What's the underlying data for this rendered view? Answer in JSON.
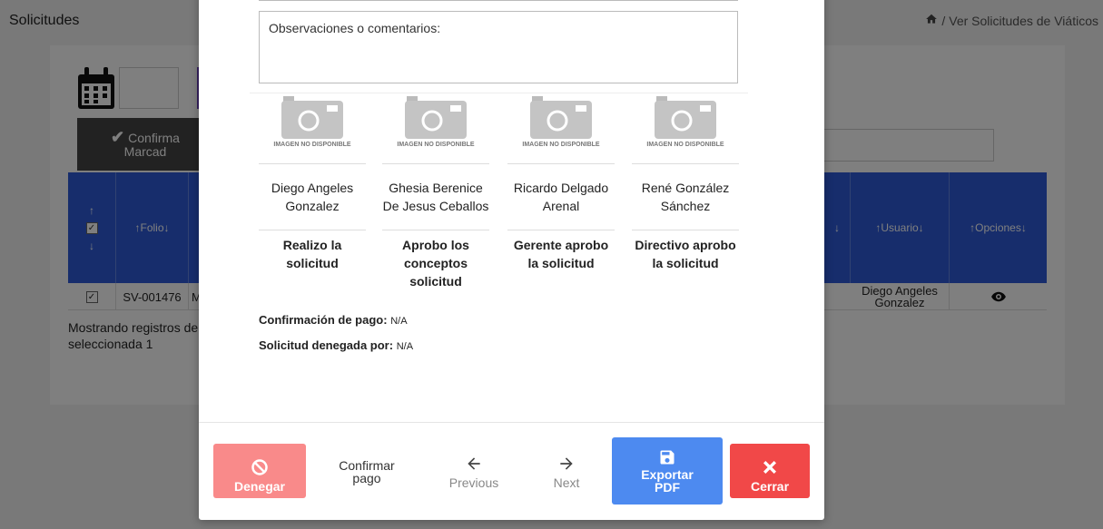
{
  "background": {
    "page_title": "Solicitudes",
    "breadcrumb": "Ver Solicitudes de Viáticos",
    "confirm_button_line1": "Confirma",
    "confirm_button_line2": "Marcad",
    "table": {
      "headers": {
        "folio": "↑Folio↓",
        "usuario": "↑Usuario↓",
        "opciones": "↑Opciones↓",
        "sort": "↓",
        "sort_up": "↑"
      },
      "row": {
        "folio": "SV-001476",
        "col3": "M",
        "usuario": "Diego Angeles Gonzalez"
      }
    },
    "info_line1": "Mostrando registros de",
    "info_line2": "seleccionada 1"
  },
  "modal": {
    "observations_label": "Observaciones o comentarios:",
    "image_unavailable": "IMAGEN NO DISPONIBLE",
    "signatures": [
      {
        "name": "Diego Angeles Gonzalez",
        "role": "Realizo la solicitud"
      },
      {
        "name": "Ghesia Berenice De Jesus Ceballos",
        "role": "Aprobo los conceptos solicitud"
      },
      {
        "name": "Ricardo Delgado Arenal",
        "role": "Gerente aprobo la solicitud"
      },
      {
        "name": "René González Sánchez",
        "role": "Directivo aprobo la solicitud"
      }
    ],
    "payment_confirmation_label": "Confirmación de pago:",
    "payment_confirmation_value": "N/A",
    "denied_by_label": "Solicitud denegada por:",
    "denied_by_value": "N/A",
    "buttons": {
      "deny": "Denegar",
      "confirm_payment": "Confirmar pago",
      "previous": "Previous",
      "next": "Next",
      "export_pdf": "Exportar PDF",
      "close": "Cerrar"
    }
  },
  "colors": {
    "table_header": "#2e5bd8",
    "deny": "#f98a8a",
    "export": "#4d8af0",
    "close": "#f14848"
  }
}
